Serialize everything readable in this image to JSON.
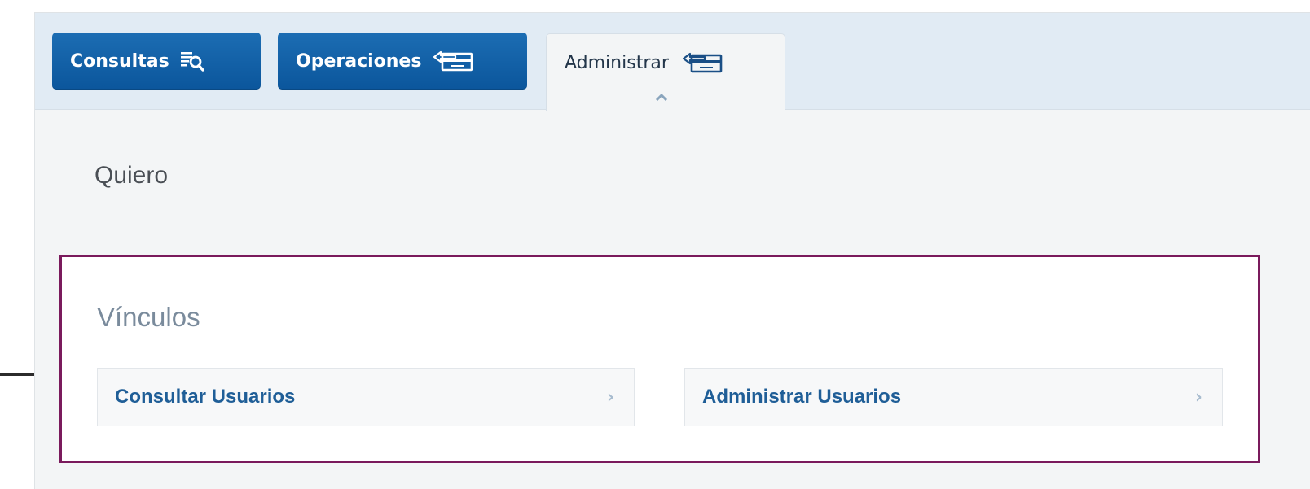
{
  "tabs": [
    {
      "label": "Consultas",
      "icon": "search-list-icon",
      "active": false
    },
    {
      "label": "Operaciones",
      "icon": "card-transfer-icon",
      "active": false
    },
    {
      "label": "Administrar",
      "icon": "card-transfer-icon",
      "active": true
    }
  ],
  "main": {
    "heading": "Quiero",
    "links_section": {
      "title": "Vínculos",
      "items": [
        {
          "label": "Consultar Usuarios",
          "chevron": "›"
        },
        {
          "label": "Administrar Usuarios",
          "chevron": "›"
        }
      ]
    }
  },
  "colors": {
    "tab_blue": "#0b5ea8",
    "highlight_border": "#7a1a5c",
    "link_text": "#1f5e97"
  }
}
